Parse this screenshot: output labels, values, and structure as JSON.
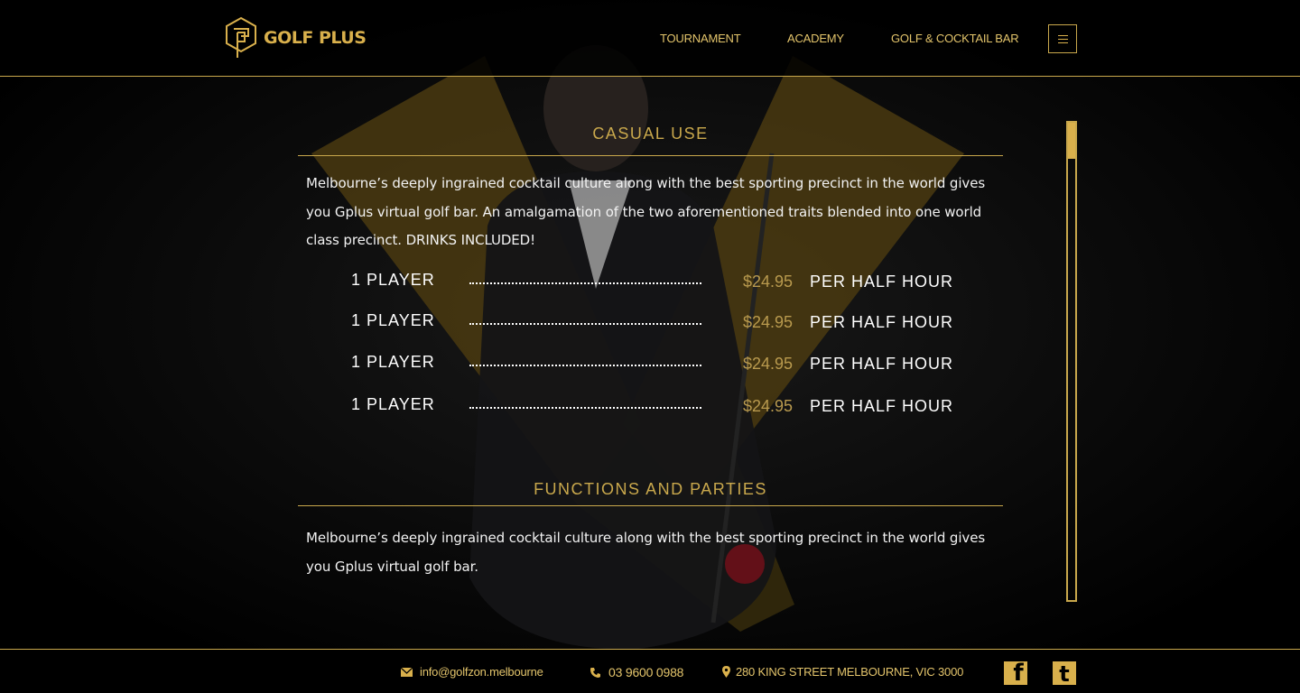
{
  "brand": {
    "name": "GOLF PLUS"
  },
  "nav": {
    "items": [
      {
        "label": "TOURNAMENT"
      },
      {
        "label": "ACADEMY"
      },
      {
        "label": "GOLF & COCKTAIL BAR"
      }
    ]
  },
  "sections": [
    {
      "title": "CASUAL USE",
      "text": "Melbourne’s deeply ingrained cocktail culture along with the best sporting precinct in the world gives you Gplus virtual golf bar. An amalgamation of the two aforementioned traits blended into one world class precinct. DRINKS INCLUDED!",
      "prices": [
        {
          "label": "1 PLAYER",
          "price": "$24.95",
          "unit": "PER HALF HOUR"
        },
        {
          "label": "1 PLAYER",
          "price": "$24.95",
          "unit": "PER HALF HOUR"
        },
        {
          "label": "1 PLAYER",
          "price": "$24.95",
          "unit": "PER HALF HOUR"
        },
        {
          "label": "1 PLAYER",
          "price": "$24.95",
          "unit": "PER HALF HOUR"
        }
      ]
    },
    {
      "title": "FUNCTIONS AND PARTIES",
      "text": "Melbourne’s deeply ingrained cocktail culture along with the best sporting precinct in the world gives you Gplus virtual golf bar."
    }
  ],
  "footer": {
    "email": "info@golfzon.melbourne",
    "phone": "03 9600 0988",
    "address": "280 KING STREET MELBOURNE, VIC 3000",
    "social": [
      {
        "icon": "facebook-icon",
        "glyph": "f"
      },
      {
        "icon": "twitter-icon",
        "glyph": "t"
      }
    ]
  },
  "colors": {
    "accent": "#d9b04c",
    "rule": "#c9a84c",
    "background": "#000000"
  }
}
